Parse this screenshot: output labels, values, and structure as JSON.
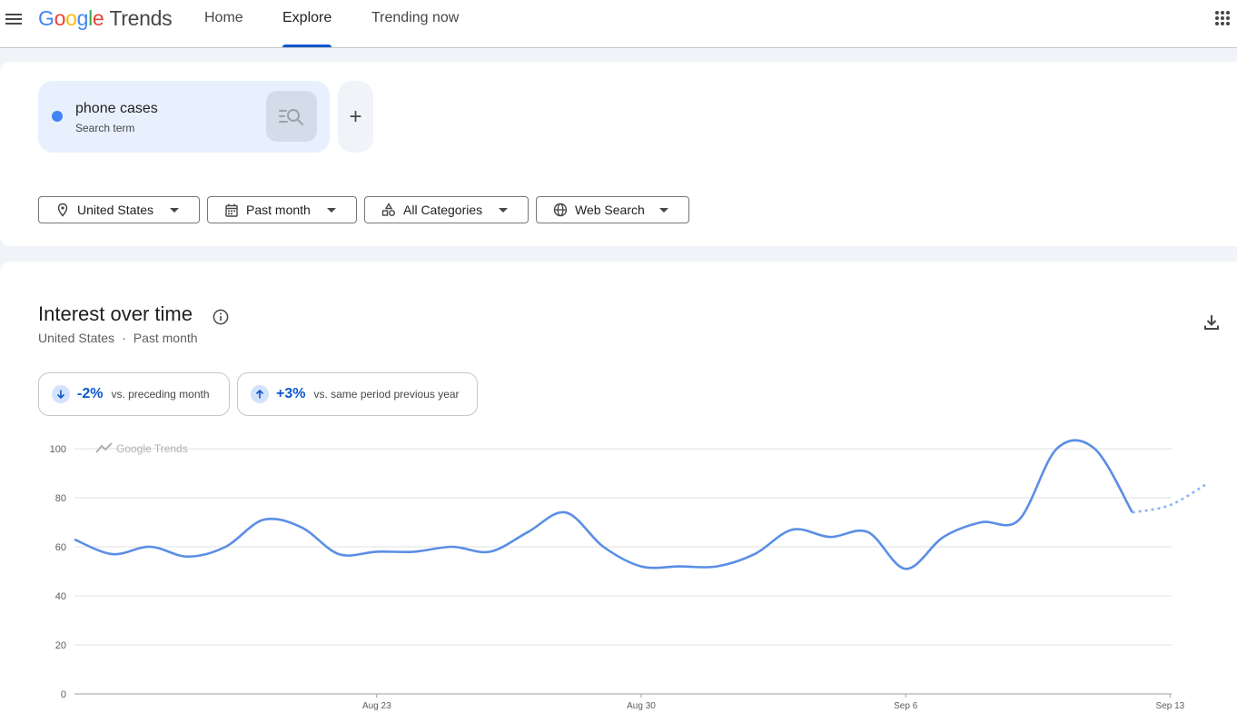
{
  "header": {
    "logo_google": "Google",
    "logo_product": "Trends",
    "tabs": [
      {
        "label": "Home"
      },
      {
        "label": "Explore"
      },
      {
        "label": "Trending now"
      }
    ],
    "active_tab": "Explore"
  },
  "search": {
    "term": "phone cases",
    "term_type": "Search term",
    "term_color": "#4285f4",
    "add_label": "+"
  },
  "filters": [
    {
      "label": "United States",
      "icon": "location-pin-icon"
    },
    {
      "label": "Past month",
      "icon": "calendar-icon"
    },
    {
      "label": "All Categories",
      "icon": "categories-icon"
    },
    {
      "label": "Web Search",
      "icon": "globe-icon"
    }
  ],
  "interest": {
    "title": "Interest over time",
    "subtitle_region": "United States",
    "subtitle_separator": "·",
    "subtitle_period": "Past month",
    "stats": [
      {
        "direction": "down",
        "value": "-2%",
        "label": "vs. preceding month"
      },
      {
        "direction": "up",
        "value": "+3%",
        "label": "vs. same period previous year"
      }
    ],
    "watermark": "Google Trends"
  },
  "colors": {
    "accent": "#0b57d0",
    "series": "#5b8ee6",
    "series_partial": "#8ab4f8"
  },
  "chart_data": {
    "type": "line",
    "title": "",
    "xlabel": "",
    "ylabel": "",
    "ylim": [
      0,
      100
    ],
    "yticks": [
      0,
      20,
      40,
      60,
      80,
      100
    ],
    "grid": true,
    "x": [
      "Aug 15",
      "Aug 16",
      "Aug 17",
      "Aug 18",
      "Aug 19",
      "Aug 20",
      "Aug 21",
      "Aug 22",
      "Aug 23",
      "Aug 24",
      "Aug 25",
      "Aug 26",
      "Aug 27",
      "Aug 28",
      "Aug 29",
      "Aug 30",
      "Aug 31",
      "Sep 1",
      "Sep 2",
      "Sep 3",
      "Sep 4",
      "Sep 5",
      "Sep 6",
      "Sep 7",
      "Sep 8",
      "Sep 9",
      "Sep 10",
      "Sep 11",
      "Sep 12",
      "Sep 13",
      "Sep 14"
    ],
    "xtick_labels": [
      "Aug 23",
      "Aug 30",
      "Sep 6",
      "Sep 13"
    ],
    "series": [
      {
        "values": [
          63,
          57,
          60,
          56,
          60,
          71,
          68,
          57,
          58,
          58,
          60,
          58,
          66,
          74,
          60,
          52,
          52,
          52,
          57,
          67,
          64,
          66,
          51,
          64,
          70,
          71,
          100,
          100,
          74,
          null,
          null
        ],
        "partial_values": [
          null,
          null,
          null,
          null,
          null,
          null,
          null,
          null,
          null,
          null,
          null,
          null,
          null,
          null,
          null,
          null,
          null,
          null,
          null,
          null,
          null,
          null,
          null,
          null,
          null,
          null,
          null,
          null,
          74,
          77,
          86
        ]
      }
    ]
  }
}
